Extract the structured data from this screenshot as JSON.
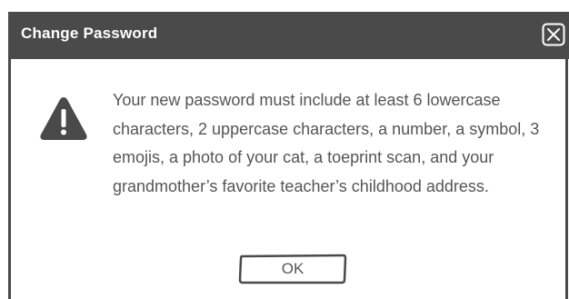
{
  "dialog": {
    "title": "Change Password",
    "message": "Your new password must include at least 6 lowercase characters, 2 uppercase characters, a number, a symbol, 3 emojis, a photo of your cat, a toeprint scan, and your grandmother’s favorite teacher’s childhood address.",
    "ok_label": "OK"
  },
  "icons": {
    "close": "close-icon",
    "warning": "warning-icon"
  },
  "colors": {
    "titlebar": "#4a4a4a",
    "title_text": "#ffffff",
    "body_text": "#555555",
    "background": "#ffffff"
  }
}
